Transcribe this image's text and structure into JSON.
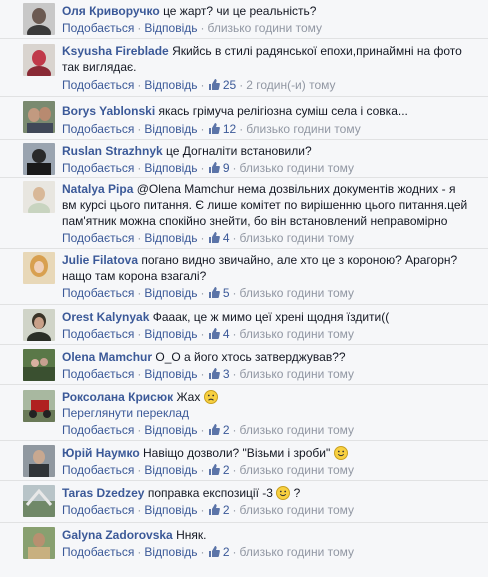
{
  "comments": [
    {
      "author": "Оля Криворучко",
      "text": "це жарт? чи це реальність?",
      "likes": "",
      "time": "близько години тому"
    },
    {
      "author": "Ksyusha Fireblade",
      "text": "Якийсь в стилі радянської епохи,принаймні на фото",
      "text2": "так виглядає.",
      "likes": "25",
      "time": "2 годин(-и) тому"
    },
    {
      "author": "Borys Yablonski",
      "text": "якась грімуча релігіозна суміш села і совка...",
      "likes": "12",
      "time": "близько години тому"
    },
    {
      "author": "Ruslan Strazhnyk",
      "text": "це Догналіти встановили?",
      "likes": "9",
      "time": "близько години тому"
    },
    {
      "author": "Natalya Pipa",
      "text": "@Olena Mamchur нема дозвільних документів жодних - я",
      "text2": "вм курсі цього питання. Є лише комітет по вирішенню цього питання.цей",
      "text3": "пам'ятник можна спокійно знейти, бо він встановлений неправомірно",
      "likes": "4",
      "time": "близько години тому"
    },
    {
      "author": "Julie Filatova",
      "text": "погано видно звичайно, але хто це з короною? Арагорн?",
      "text2": "нащо там корона взагалі?",
      "likes": "5",
      "time": "близько години тому"
    },
    {
      "author": "Orest Kalynyak",
      "text": "Фааак, це ж мимо цеї хрені щодня їздити((",
      "likes": "4",
      "time": "близько години тому"
    },
    {
      "author": "Olena Mamchur",
      "text": "О_О а його хтось затверджував??",
      "likes": "3",
      "time": "близько години тому"
    },
    {
      "author": "Роксолана Крисюк",
      "text": "Жах",
      "translate": "Переглянути переклад",
      "likes": "2",
      "time": "близько години тому"
    },
    {
      "author": "Юрій Наумко",
      "text": "Навіщо дозволи? \"Візьми і зроби\"",
      "likes": "2",
      "time": "близько години тому"
    },
    {
      "author": "Taras Dzedzey",
      "text": "поправка експозиції -3",
      "text_end": "?",
      "likes": "2",
      "time": "близько години тому"
    },
    {
      "author": "Galyna Zadorovska",
      "text": "Нняк.",
      "likes": "2",
      "time": "близько години тому"
    }
  ],
  "labels": {
    "like": "Подобається",
    "reply": "Відповідь",
    "sep": "·"
  },
  "colors": {
    "link": "#3b5998",
    "meta": "#9197a3",
    "background": "#f6f7f9"
  }
}
